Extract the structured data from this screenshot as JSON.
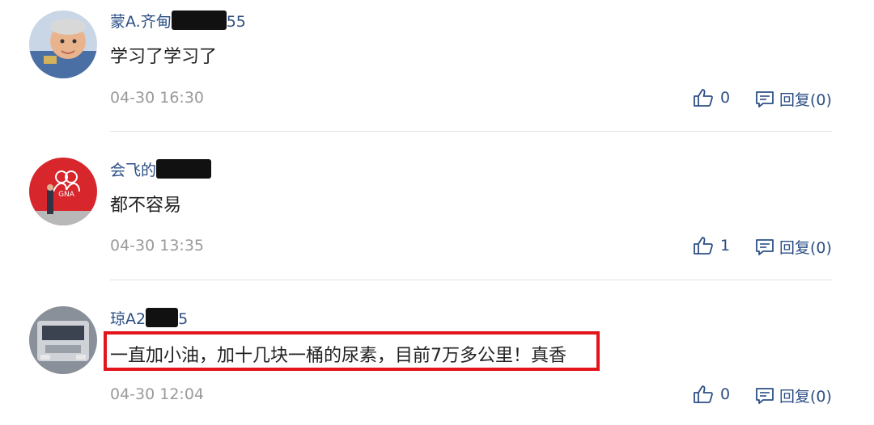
{
  "comments": [
    {
      "username": "蒙A.齐甸",
      "username_tail": "55",
      "text": "学习了学习了",
      "time": "04-30 16:30",
      "likes": "0",
      "reply_label": "回复(0)",
      "avatar_icon": "baby-photo-avatar"
    },
    {
      "username": "会飞的",
      "username_tail": "",
      "text": "都不容易",
      "time": "04-30 13:35",
      "likes": "1",
      "reply_label": "回复(0)",
      "avatar_icon": "red-logo-avatar"
    },
    {
      "username": "琼A2",
      "username_tail": "5",
      "text": "一直加小油，加十几块一桶的尿素，目前7万多公里！真香",
      "time": "04-30 12:04",
      "likes": "0",
      "reply_label": "回复(0)",
      "avatar_icon": "truck-photo-avatar"
    }
  ],
  "colors": {
    "username": "#2c4f85",
    "time": "#9a9a9a",
    "highlight_border": "#e3141c"
  }
}
